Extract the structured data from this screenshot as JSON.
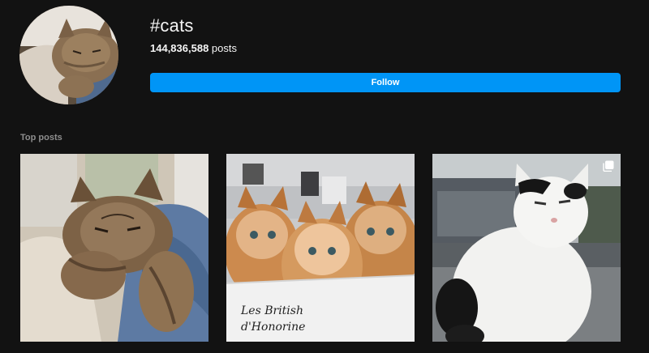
{
  "hashtag": {
    "title": "#cats",
    "post_count": "144,836,588",
    "post_count_suffix": " posts",
    "follow_label": "Follow"
  },
  "top_posts": {
    "section_label": "Top posts",
    "items": [
      {
        "subject": "fluffy tabby cat resting on knee",
        "watermark": ""
      },
      {
        "subject": "three persian kittens in a box",
        "watermark_line1": "Les British",
        "watermark_line2": "d'Honorine"
      },
      {
        "subject": "white and black cat outdoors",
        "has_carousel": true
      }
    ]
  },
  "colors": {
    "background": "#121212",
    "accent": "#0095f6",
    "muted_text": "#8e8e8e"
  },
  "icons": {
    "carousel": "multiple-posts-icon"
  }
}
